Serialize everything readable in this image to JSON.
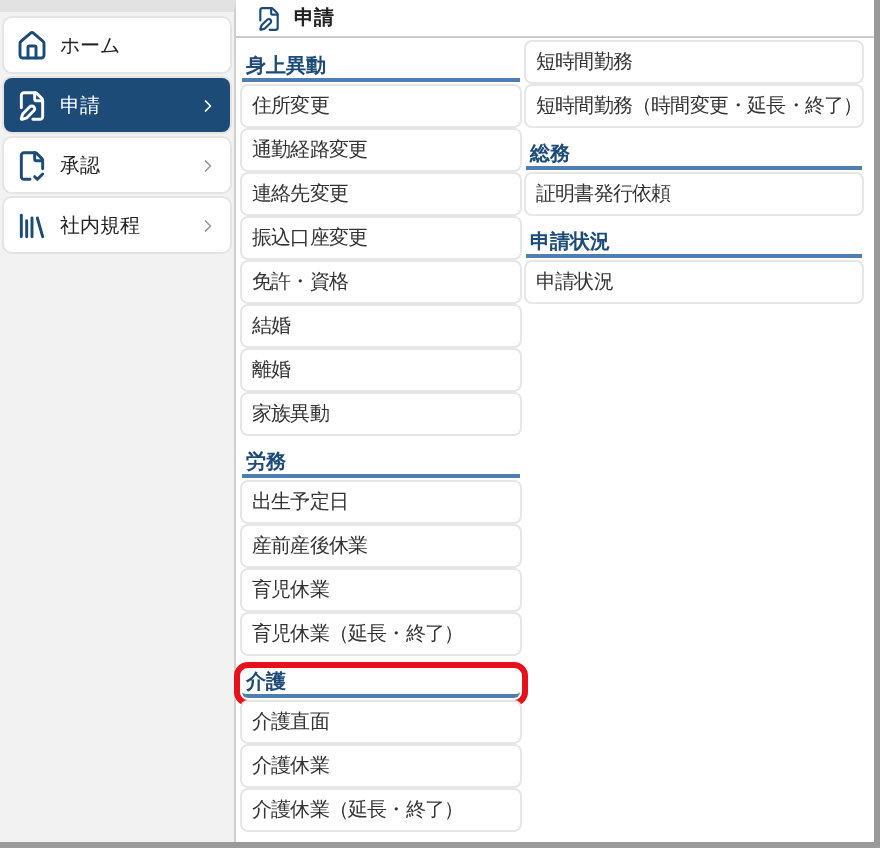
{
  "sidebar": {
    "items": [
      {
        "label": "ホーム",
        "selected": false,
        "chevron": false
      },
      {
        "label": "申請",
        "selected": true,
        "chevron": true
      },
      {
        "label": "承認",
        "selected": false,
        "chevron": true
      },
      {
        "label": "社内規程",
        "selected": false,
        "chevron": true
      }
    ]
  },
  "panel": {
    "title": "申請",
    "columns": [
      {
        "sections": [
          {
            "heading": "身上異動",
            "highlighted": false,
            "items": [
              "住所変更",
              "通勤経路変更",
              "連絡先変更",
              "振込口座変更",
              "免許・資格",
              "結婚",
              "離婚",
              "家族異動"
            ]
          },
          {
            "heading": "労務",
            "highlighted": false,
            "items": [
              "出生予定日",
              "産前産後休業",
              "育児休業",
              "育児休業（延長・終了）"
            ]
          },
          {
            "heading": "介護",
            "highlighted": true,
            "items": [
              "介護直面",
              "介護休業",
              "介護休業（延長・終了）"
            ]
          }
        ]
      },
      {
        "sections": [
          {
            "items": [
              "短時間勤務",
              "短時間勤務（時間変更・延長・終了）"
            ]
          },
          {
            "heading": "総務",
            "highlighted": false,
            "items": [
              "証明書発行依頼"
            ]
          },
          {
            "heading": "申請状況",
            "highlighted": false,
            "items": [
              "申請状況"
            ]
          }
        ]
      }
    ]
  }
}
